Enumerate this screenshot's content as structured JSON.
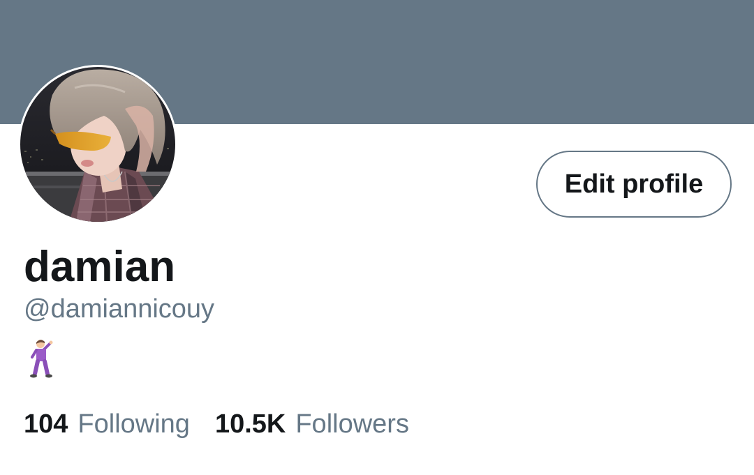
{
  "colors": {
    "banner": "#657786",
    "text_primary": "#14171a",
    "text_secondary": "#657786",
    "button_border": "#657786"
  },
  "profile": {
    "display_name": "damian",
    "handle": "@damiannicouy",
    "bio_emoji": "man-dancing-emoji",
    "avatar": "profile-photo"
  },
  "actions": {
    "edit_profile_label": "Edit profile"
  },
  "stats": {
    "following_count": "104",
    "following_label": "Following",
    "followers_count": "10.5K",
    "followers_label": "Followers"
  }
}
